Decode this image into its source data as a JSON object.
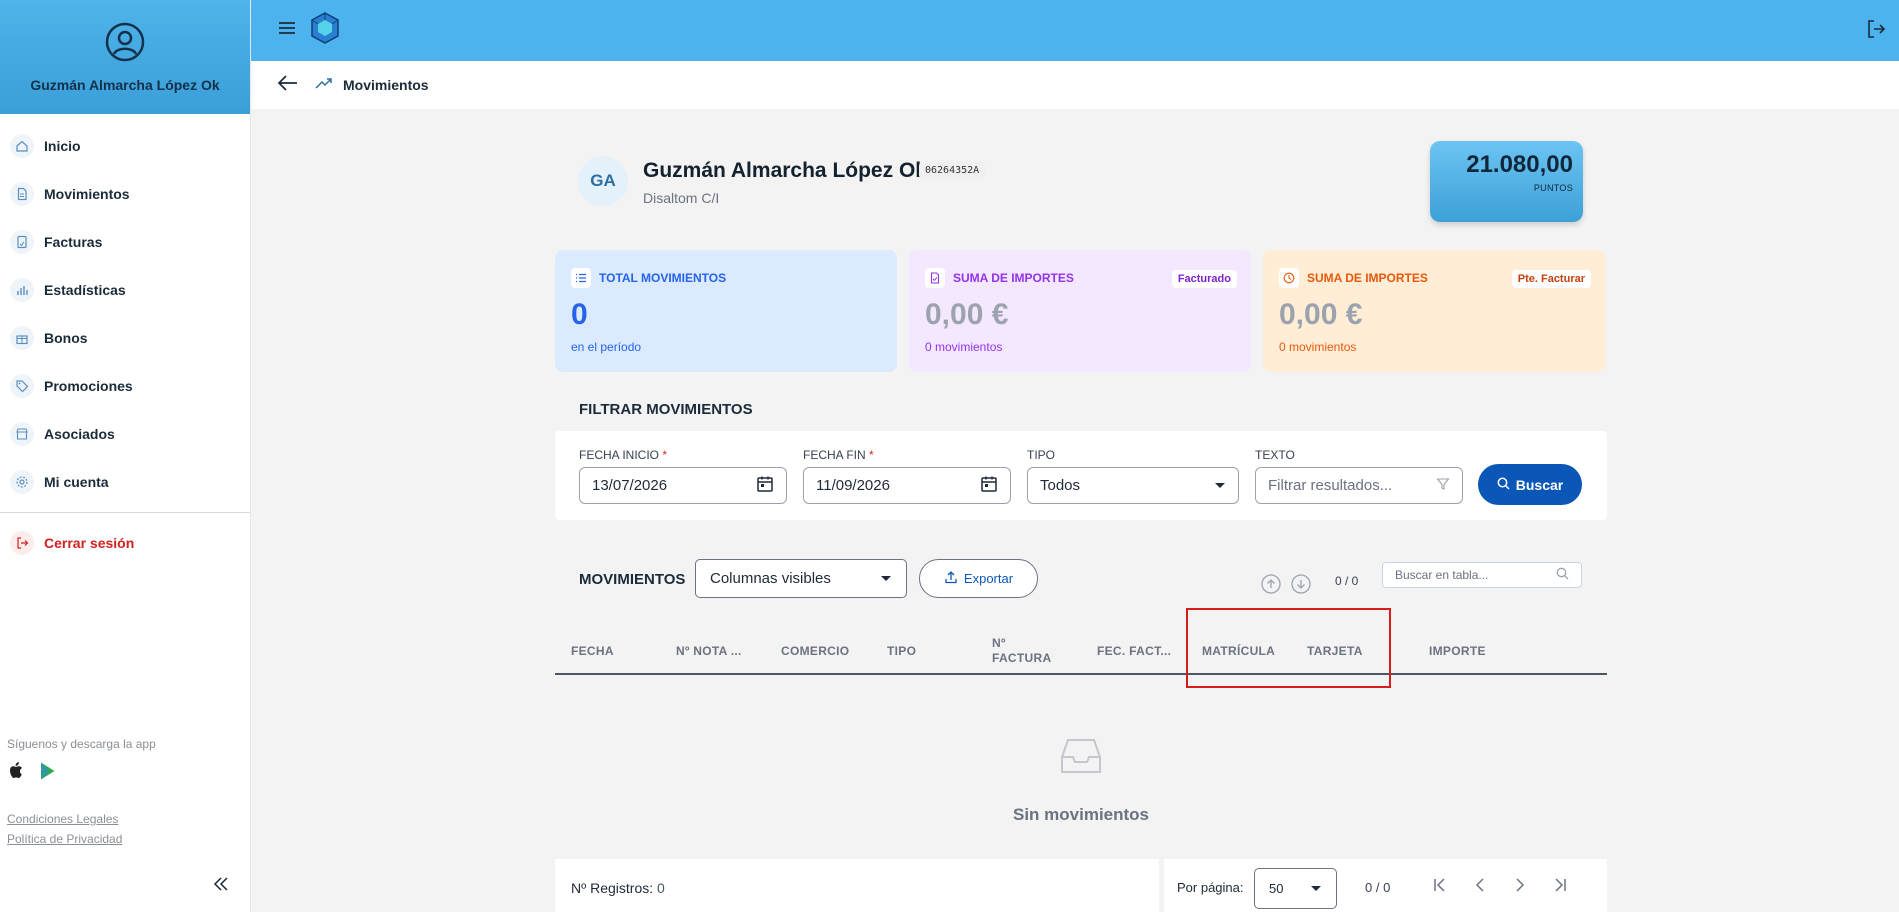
{
  "sidebar": {
    "user_name": "Guzmán Almarcha López Ok",
    "items": [
      {
        "label": "Inicio",
        "icon": "home-icon"
      },
      {
        "label": "Movimientos",
        "icon": "document-icon"
      },
      {
        "label": "Facturas",
        "icon": "invoice-icon"
      },
      {
        "label": "Estadísticas",
        "icon": "bar-chart-icon"
      },
      {
        "label": "Bonos",
        "icon": "gift-icon"
      },
      {
        "label": "Promociones",
        "icon": "tag-icon"
      },
      {
        "label": "Asociados",
        "icon": "store-icon"
      },
      {
        "label": "Mi cuenta",
        "icon": "gear-icon"
      }
    ],
    "logout_label": "Cerrar sesión",
    "follow_text": "Síguenos y descarga la app",
    "legal_label": "Condiciones Legales",
    "privacy_label": "Política de Privacidad"
  },
  "breadcrumb": {
    "title": "Movimientos"
  },
  "profile": {
    "initials": "GA",
    "name": "Guzmán Almarcha López Ok",
    "code": "06264352A",
    "company": "Disaltom C/I",
    "points_value": "21.080,00",
    "points_label": "PUNTOS"
  },
  "cards": [
    {
      "title": "TOTAL MOVIMIENTOS",
      "value": "0",
      "sub": "en el período",
      "badge": ""
    },
    {
      "title": "SUMA DE IMPORTES",
      "value": "0,00 €",
      "sub": "0 movimientos",
      "badge": "Facturado"
    },
    {
      "title": "SUMA DE IMPORTES",
      "value": "0,00 €",
      "sub": "0 movimientos",
      "badge": "Pte. Facturar"
    }
  ],
  "filter": {
    "title": "FILTRAR MOVIMIENTOS",
    "fecha_inicio_label": "FECHA INICIO",
    "fecha_inicio_value": "13/07/2026",
    "fecha_fin_label": "FECHA FIN",
    "fecha_fin_value": "11/09/2026",
    "tipo_label": "TIPO",
    "tipo_value": "Todos",
    "texto_label": "TEXTO",
    "texto_placeholder": "Filtrar resultados...",
    "buscar_label": "Buscar",
    "required_mark": "*"
  },
  "movimientos": {
    "title": "MOVIMIENTOS",
    "columns_select": "Columnas visibles",
    "export_label": "Exportar",
    "count": "0 / 0",
    "search_placeholder": "Buscar en tabla...",
    "headers": [
      "FECHA",
      "Nº NOTA ...",
      "COMERCIO",
      "TIPO",
      "Nº FACTURA",
      "FEC. FACT...",
      "MATRÍCULA",
      "TARJETA",
      "IMPORTE"
    ],
    "empty_text": "Sin movimientos"
  },
  "footer": {
    "registros_label": "Nº Registros:",
    "registros_value": "0",
    "per_page_label": "Por página:",
    "per_page_value": "50",
    "page_count": "0 / 0"
  }
}
